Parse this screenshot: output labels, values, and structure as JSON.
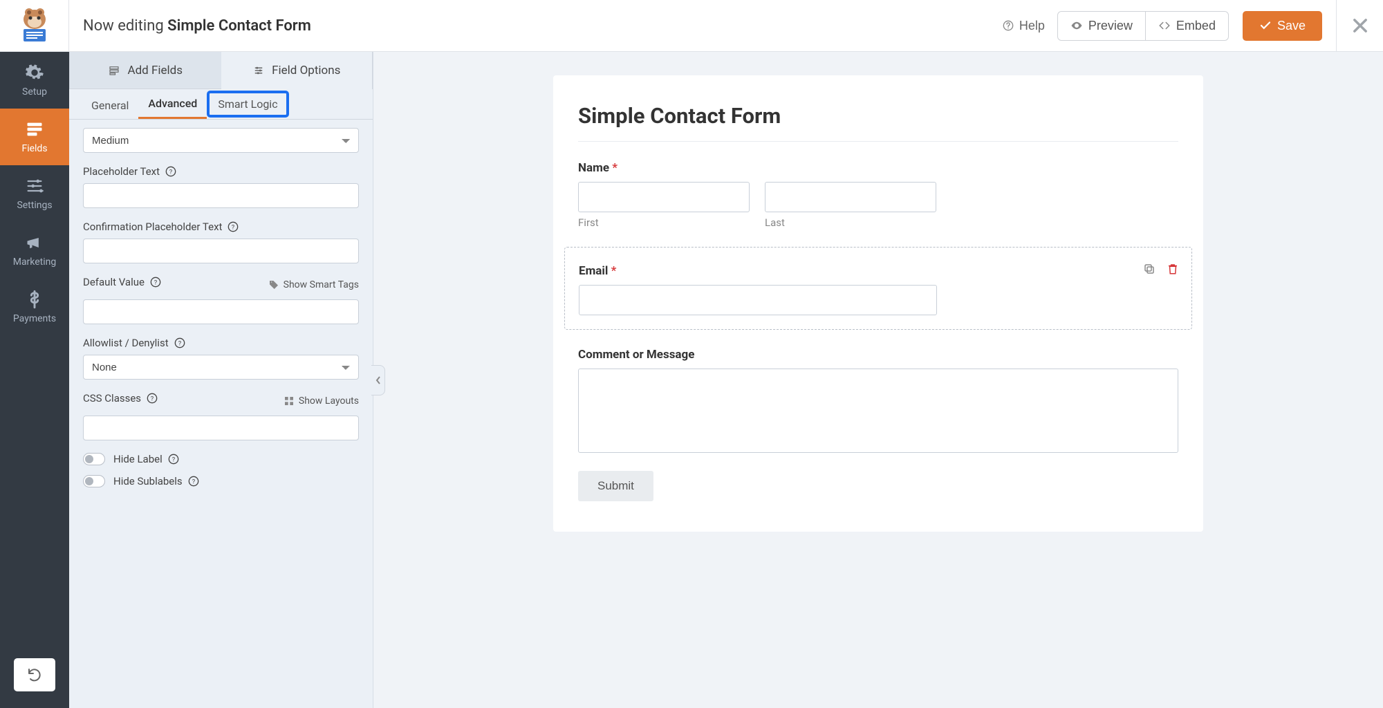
{
  "topbar": {
    "editing_prefix": "Now editing ",
    "form_name": "Simple Contact Form",
    "help": "Help",
    "preview": "Preview",
    "embed": "Embed",
    "save": "Save"
  },
  "nav": {
    "setup": "Setup",
    "fields": "Fields",
    "settings": "Settings",
    "marketing": "Marketing",
    "payments": "Payments"
  },
  "panel": {
    "tab_add": "Add Fields",
    "tab_options": "Field Options",
    "sub_general": "General",
    "sub_advanced": "Advanced",
    "sub_smart": "Smart Logic",
    "size_value": "Medium",
    "placeholder_label": "Placeholder Text",
    "confirmation_label": "Confirmation Placeholder Text",
    "default_label": "Default Value",
    "smart_tags": "Show Smart Tags",
    "allowlist_label": "Allowlist / Denylist",
    "allowlist_value": "None",
    "css_label": "CSS Classes",
    "layouts": "Show Layouts",
    "hide_label": "Hide Label",
    "hide_sublabels": "Hide Sublabels"
  },
  "form": {
    "title": "Simple Contact Form",
    "name_label": "Name",
    "first": "First",
    "last": "Last",
    "email_label": "Email",
    "comment_label": "Comment or Message",
    "submit": "Submit"
  }
}
